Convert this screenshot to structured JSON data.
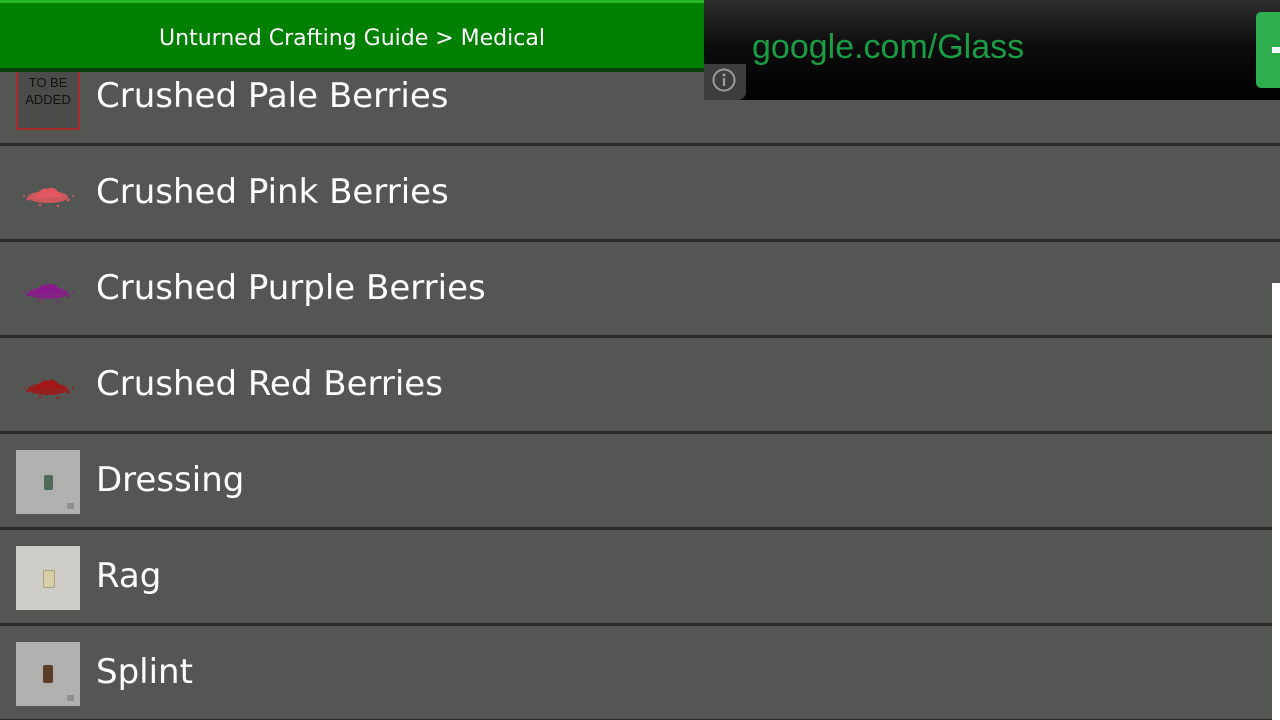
{
  "header": {
    "title": "Unturned Crafting Guide > Medical",
    "colors": {
      "bar": "#008000",
      "bar_top": "#25b625",
      "bar_bottom": "#0c3f0c"
    }
  },
  "ad": {
    "url_text": "google.com/Glass",
    "url_color": "#1a9c44",
    "cta_color": "#2fae4f",
    "info_icon": "info-icon"
  },
  "list": {
    "items": [
      {
        "label": "Crushed Pale Berries",
        "thumb": "to-be-added",
        "thumb_text": "TO BE ADDED"
      },
      {
        "label": "Crushed Pink Berries",
        "thumb": "pink-powder-icon",
        "color": "#e0585e"
      },
      {
        "label": "Crushed Purple Berries",
        "thumb": "purple-powder-icon",
        "color": "#8a1a8c"
      },
      {
        "label": "Crushed Red Berries",
        "thumb": "red-powder-icon",
        "color": "#a01818"
      },
      {
        "label": "Dressing",
        "thumb": "dressing-icon",
        "color": "#4f6a58"
      },
      {
        "label": "Rag",
        "thumb": "rag-icon",
        "color": "#d6cfa8"
      },
      {
        "label": "Splint",
        "thumb": "splint-icon",
        "color": "#5b3b2a"
      }
    ],
    "colors": {
      "row_bg": "#545653",
      "divider": "#2c2d2b",
      "text": "#ffffff"
    }
  }
}
